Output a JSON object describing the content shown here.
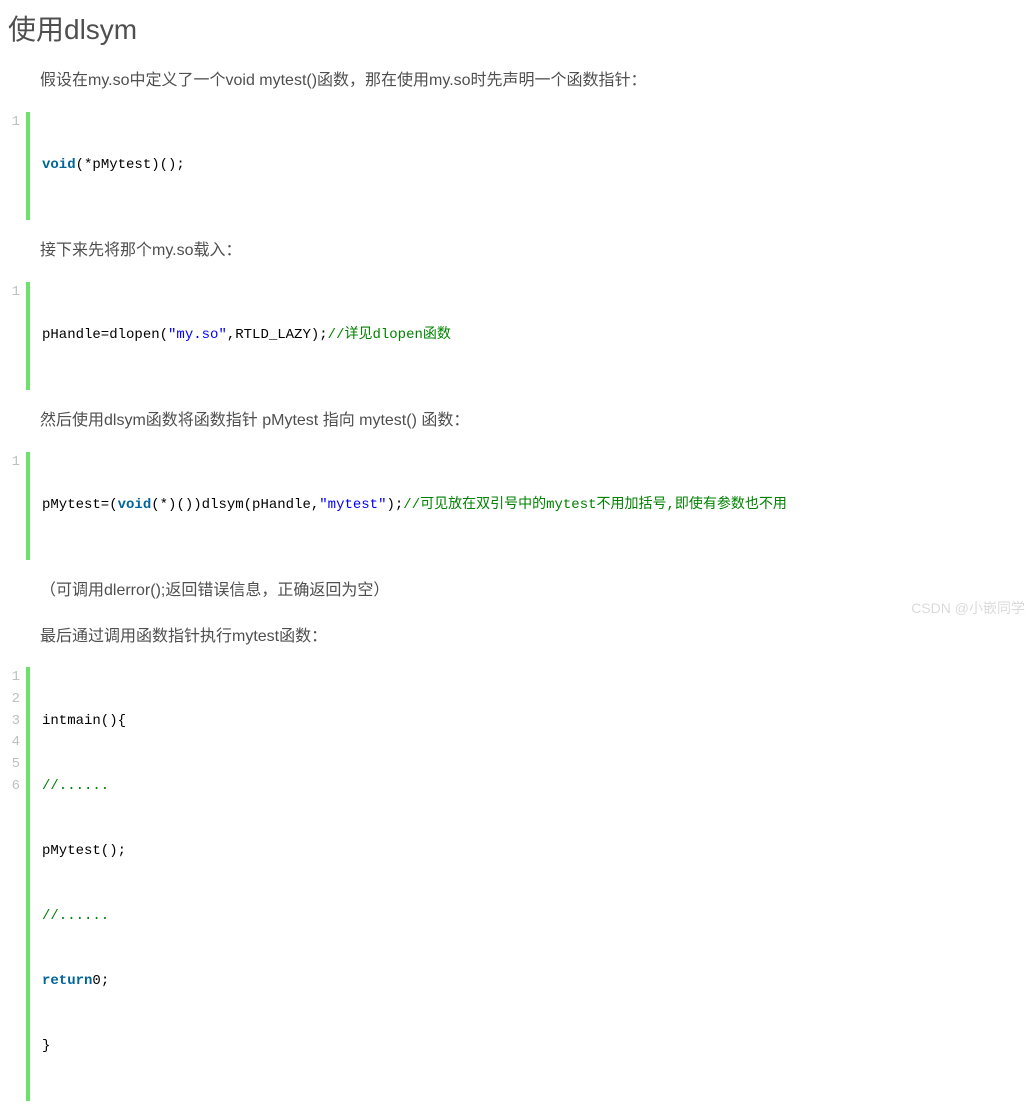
{
  "heading": "使用dlsym",
  "p1": "假设在my.so中定义了一个void mytest()函数，那在使用my.so时先声明一个函数指针：",
  "code1": {
    "kw": "void",
    "rest": "(*pMytest)();"
  },
  "p2": "接下来先将那个my.so载入：",
  "code2": {
    "pre": "pHandle=dlopen(",
    "str": "\"my.so\"",
    "mid": ",RTLD_LAZY);",
    "cmt": "//详见dlopen函数"
  },
  "p3": "然后使用dlsym函数将函数指针 pMytest 指向 mytest() 函数：",
  "code3": {
    "pre": "pMytest=(",
    "kw": "void",
    "mid1": "(*)())dlsym(pHandle,",
    "str": "\"mytest\"",
    "mid2": ");",
    "cmt": "//可见放在双引号中的mytest不用加括号,即使有参数也不用"
  },
  "p4": "（可调用dlerror();返回错误信息，正确返回为空）",
  "p5": "最后通过调用函数指针执行mytest函数：",
  "code4": {
    "l1": "intmain(){",
    "l2": "//......",
    "l3": "pMytest();",
    "l4": "//......",
    "l5a": "return",
    "l5b": "0;",
    "l6": "}"
  },
  "ln": {
    "n1": "1",
    "n2": "2",
    "n3": "3",
    "n4": "4",
    "n5": "5",
    "n6": "6"
  },
  "watermark": "CSDN @小嵌同学"
}
